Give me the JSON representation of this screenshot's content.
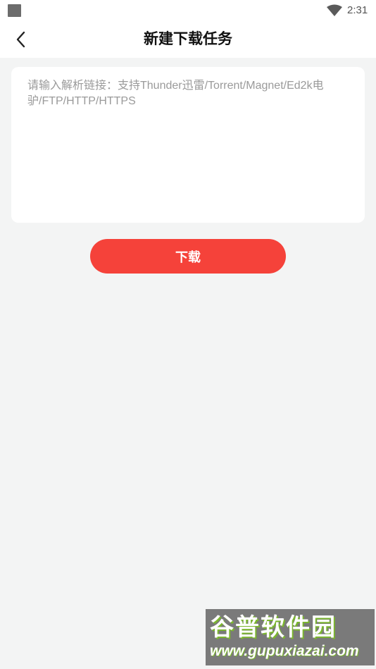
{
  "status_bar": {
    "time": "2:31",
    "icons": [
      "notification-square-icon",
      "wifi-icon"
    ]
  },
  "header": {
    "title": "新建下载任务",
    "back_icon": "chevron-left-icon"
  },
  "link_input": {
    "value": "",
    "placeholder": "请输入解析链接：支持Thunder迅雷/Torrent/Magnet/Ed2k电驴/FTP/HTTP/HTTPS"
  },
  "download_button": {
    "label": "下载"
  },
  "watermark": {
    "title": "谷普软件园",
    "url": "www.gupuxiazai.com"
  },
  "colors": {
    "accent": "#f5423a",
    "background": "#f3f4f4",
    "card": "#ffffff",
    "placeholder": "#9a9a9a"
  }
}
